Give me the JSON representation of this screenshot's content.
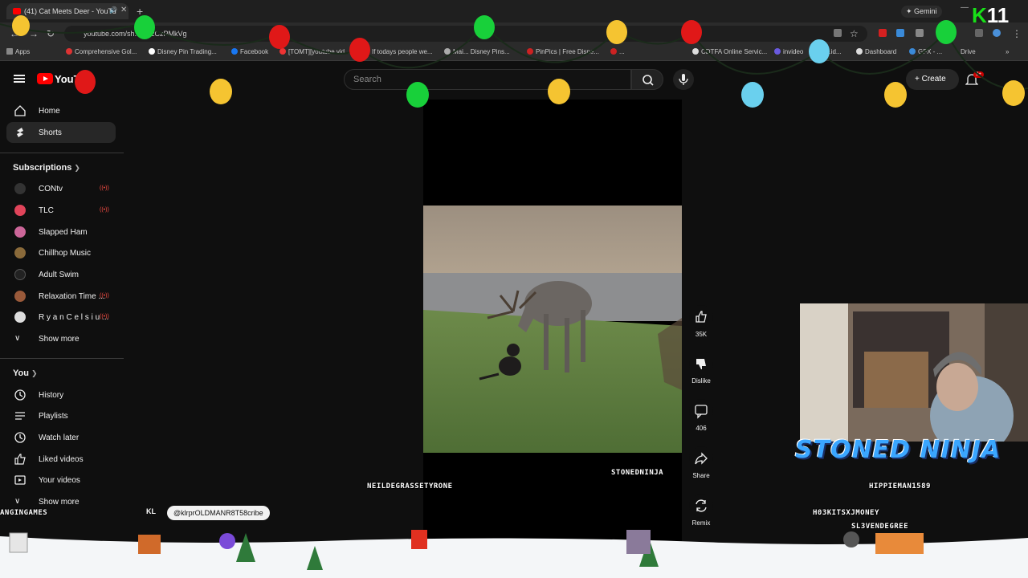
{
  "browser": {
    "tab_title": "(41) Cat Meets Deer - YouTu",
    "url": "youtube.com/sh...UK2CzPMkVg",
    "gemini_label": "Gemini",
    "bookmarks": [
      "Apps",
      "Comprehensive Gol...",
      "Disney Pin Trading...",
      "Facebook",
      "[TOMT][youtube vid...",
      "If todays people we...",
      "Mai... Disney Pins...",
      "PinPics | Free Disne...",
      "...",
      "CDTFA Online Servic...",
      "invideo",
      "...id...",
      "Dashboard",
      "GFX - ...",
      "Drive"
    ]
  },
  "header": {
    "logo_text": "YouT",
    "search_placeholder": "Search",
    "create_label": "Create",
    "notif_badge": "9+"
  },
  "sidebar": {
    "home": "Home",
    "shorts": "Shorts",
    "subscriptions_heading": "Subscriptions",
    "channels": [
      {
        "name": "CONtv",
        "color": "#333333"
      },
      {
        "name": "TLC",
        "color": "#e0445a"
      },
      {
        "name": "Slapped Ham",
        "color": "#cc6699"
      },
      {
        "name": "Chillhop Music",
        "color": "#8a6a3a"
      },
      {
        "name": "Adult Swim",
        "color": "#222222"
      },
      {
        "name": "Relaxation Time ...",
        "color": "#9a5a3a"
      },
      {
        "name": "R y a n C e l s i u ...",
        "color": "#dddddd"
      }
    ],
    "show_more_1": "Show more",
    "you_heading": "You",
    "you_items": [
      "History",
      "Playlists",
      "Watch later",
      "Liked videos",
      "Your videos"
    ],
    "show_more_2": "Show more"
  },
  "actions": {
    "like_count": "35K",
    "dislike_label": "Dislike",
    "comment_count": "406",
    "share_label": "Share",
    "remix_label": "Remix"
  },
  "overlay": {
    "streamer_title": "STONED NINJA",
    "k_label": "K",
    "eleven_label": "11",
    "gamer_names": [
      "ANGINGAMES",
      "NEILDEGRASSETYRONE",
      "STONEDNINJA",
      "HIPPIEMAN1589",
      "H03KITSXJMONEY",
      "SL3VENDEGREE"
    ],
    "chat_kl": "KL",
    "chat_text": "@klrprOLDMANR8T58cribe"
  },
  "colors": {
    "bg": "#0f0f0f",
    "accent_red": "#ff0000",
    "title_blue": "#3aa6ff"
  }
}
